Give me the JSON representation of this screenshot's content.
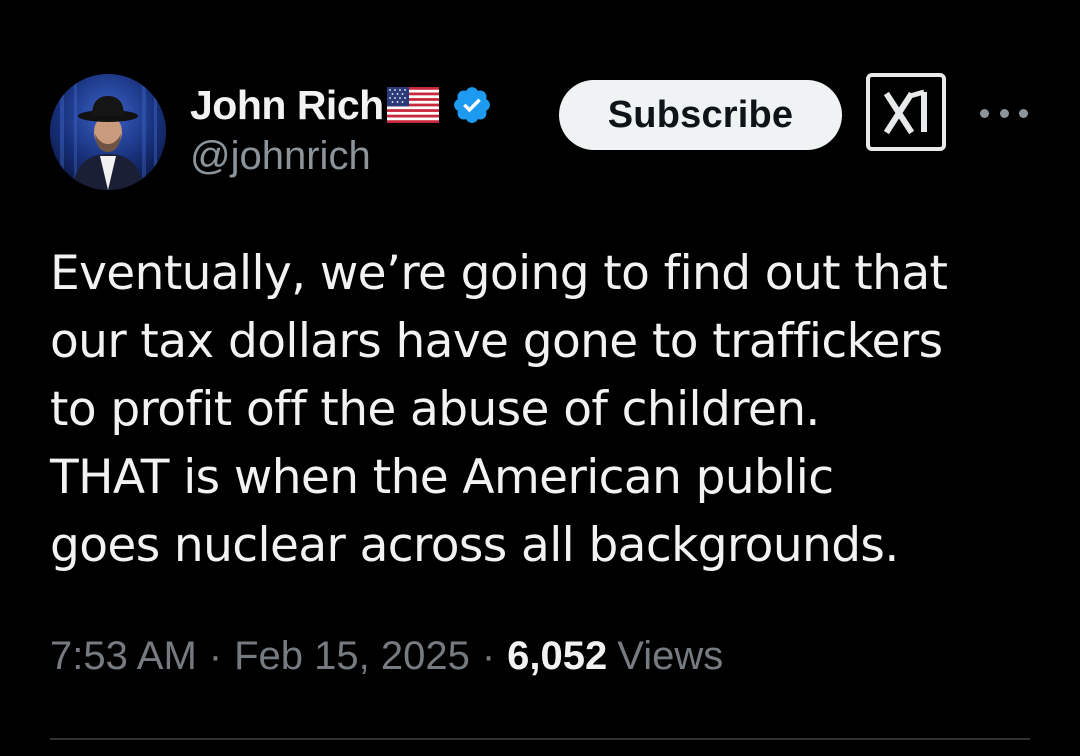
{
  "author": {
    "display_name": "John Rich",
    "handle": "@johnrich",
    "flag_icon": "us-flag-icon",
    "verified_icon": "verified-badge-icon",
    "verified_color": "#1d9bf0"
  },
  "actions": {
    "subscribe_label": "Subscribe",
    "grok_icon": "grok-icon",
    "more_icon": "more-options-icon"
  },
  "tweet": {
    "lines": [
      "Eventually, we’re going to find out that",
      "our tax dollars have gone to traffickers",
      "to profit off the abuse of children.",
      "THAT is when the American public",
      "goes nuclear across all backgrounds."
    ]
  },
  "meta": {
    "time": "7:53 AM",
    "separator": "·",
    "date": "Feb 15, 2025",
    "views_count": "6,052",
    "views_label": "Views"
  },
  "colors": {
    "background": "#000000",
    "text_primary": "#f2f2f2",
    "text_secondary": "#757b80",
    "button_bg": "#eff3f4",
    "divider": "#2f3336"
  }
}
